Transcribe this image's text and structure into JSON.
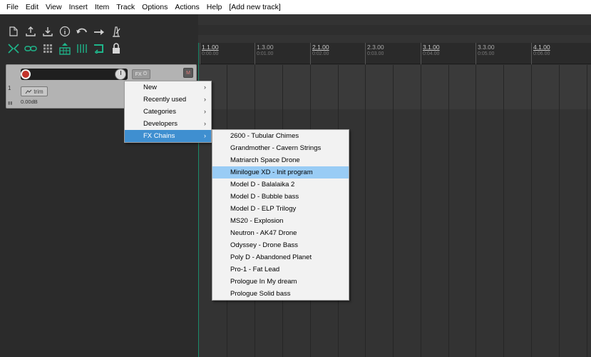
{
  "menubar": {
    "items": [
      "File",
      "Edit",
      "View",
      "Insert",
      "Item",
      "Track",
      "Options",
      "Actions",
      "Help",
      "[Add new track]"
    ]
  },
  "toolbar": {
    "row1_icons": [
      "new-project-icon",
      "save-upload-icon",
      "download-icon",
      "info-icon",
      "undo-icon",
      "redo-icon",
      "metronome-icon"
    ],
    "row2_icons": [
      "ripple-edit-icon",
      "link-icon",
      "grid-icon",
      "snap-icon",
      "grid-lines-icon",
      "loop-icon",
      "lock-icon"
    ],
    "accent_color": "#1fb58a"
  },
  "ruler": {
    "marks": [
      {
        "bar": "1.1.00",
        "time": "0:00.00",
        "major": true
      },
      {
        "bar": "1.3.00",
        "time": "0:01.00",
        "major": false
      },
      {
        "bar": "2.1.00",
        "time": "0:02.00",
        "major": true
      },
      {
        "bar": "2.3.00",
        "time": "0:03.00",
        "major": false
      },
      {
        "bar": "3.1.00",
        "time": "0:04.00",
        "major": true
      },
      {
        "bar": "3.3.00",
        "time": "0:05.00",
        "major": false
      },
      {
        "bar": "4.1.00",
        "time": "0:06.00",
        "major": true
      }
    ]
  },
  "track": {
    "number": "1",
    "fx_label": "FX",
    "power_label": "⏻",
    "mute_label": "M",
    "trim_label": "trim",
    "volume": "0.00dB"
  },
  "fx_menu": {
    "items": [
      {
        "label": "New"
      },
      {
        "label": "Recently used"
      },
      {
        "label": "Categories"
      },
      {
        "label": "Developers"
      },
      {
        "label": "FX Chains"
      }
    ],
    "active": "FX Chains"
  },
  "fx_chains_submenu": {
    "items": [
      "2600 - Tubular Chimes",
      "Grandmother - Cavern Strings",
      "Matriarch Space Drone",
      "Minilogue XD - Init program",
      "Model D - Balalaika 2",
      "Model D - Bubble bass",
      "Model D - ELP Trilogy",
      "MS20 - Explosion",
      "Neutron - AK47 Drone",
      "Odyssey - Drone Bass",
      "Poly D - Abandoned Planet",
      "Pro-1 - Fat Lead",
      "Prologue In My dream",
      "Prologue Solid bass"
    ],
    "highlighted": "Minilogue XD - Init program"
  },
  "colors": {
    "menu_highlight": "#99ccf5",
    "menu_active": "#3f8fd0",
    "record": "#c2332b"
  }
}
